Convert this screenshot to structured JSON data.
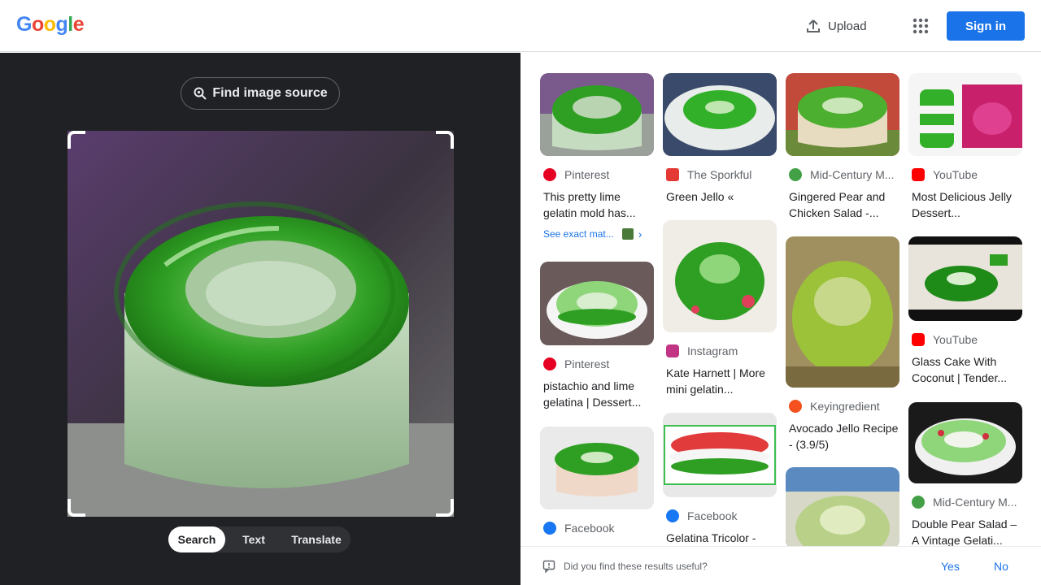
{
  "header": {
    "logo_letters": [
      {
        "char": "G",
        "color": "#4285F4"
      },
      {
        "char": "o",
        "color": "#EA4335"
      },
      {
        "char": "o",
        "color": "#FBBC05"
      },
      {
        "char": "g",
        "color": "#4285F4"
      },
      {
        "char": "l",
        "color": "#34A853"
      },
      {
        "char": "e",
        "color": "#EA4335"
      }
    ],
    "upload_label": "Upload",
    "apps_icon": "apps-grid-icon",
    "signin_label": "Sign in"
  },
  "left_panel": {
    "find_source_label": "Find image source",
    "modes": [
      {
        "label": "Search",
        "active": true
      },
      {
        "label": "Text",
        "active": false
      },
      {
        "label": "Translate",
        "active": false
      }
    ]
  },
  "results": [
    {
      "source": "Pinterest",
      "source_icon": "pinterest-icon",
      "icon_color": "#E60023",
      "title": "This pretty lime gelatin mold has...",
      "exact_match": "See exact mat..."
    },
    {
      "source": "The Sporkful",
      "source_icon": "sporkful-icon",
      "icon_color": "#E53935",
      "title": "Green Jello «"
    },
    {
      "source": "Mid-Century M...",
      "source_icon": "watermelon-icon",
      "icon_color": "#43A047",
      "title": "Gingered Pear and Chicken Salad -..."
    },
    {
      "source": "YouTube",
      "source_icon": "youtube-icon",
      "icon_color": "#FF0000",
      "title": "Most Delicious Jelly Dessert..."
    },
    {
      "source": "Pinterest",
      "source_icon": "pinterest-icon",
      "icon_color": "#E60023",
      "title": "pistachio and lime gelatina | Dessert..."
    },
    {
      "source": "Instagram",
      "source_icon": "instagram-icon",
      "icon_color": "#C13584",
      "title": "Kate Harnett | More mini gelatin..."
    },
    {
      "source": "Keyingredient",
      "source_icon": "keyingredient-icon",
      "icon_color": "#F4511E",
      "title": "Avocado Jello Recipe - (3.9/5)"
    },
    {
      "source": "YouTube",
      "source_icon": "youtube-icon",
      "icon_color": "#FF0000",
      "title": "Glass Cake With Coconut | Tender..."
    },
    {
      "source": "Facebook",
      "source_icon": "facebook-icon",
      "icon_color": "#1877F2",
      "title": ""
    },
    {
      "source": "Facebook",
      "source_icon": "facebook-icon",
      "icon_color": "#1877F2",
      "title": "Gelatina Tricolor -"
    },
    {
      "source": "",
      "source_icon": "",
      "icon_color": "",
      "title": ""
    },
    {
      "source": "Mid-Century M...",
      "source_icon": "watermelon-icon",
      "icon_color": "#43A047",
      "title": "Double Pear Salad – A Vintage Gelati..."
    }
  ],
  "feedback": {
    "question": "Did you find these results useful?",
    "yes_label": "Yes",
    "no_label": "No"
  }
}
